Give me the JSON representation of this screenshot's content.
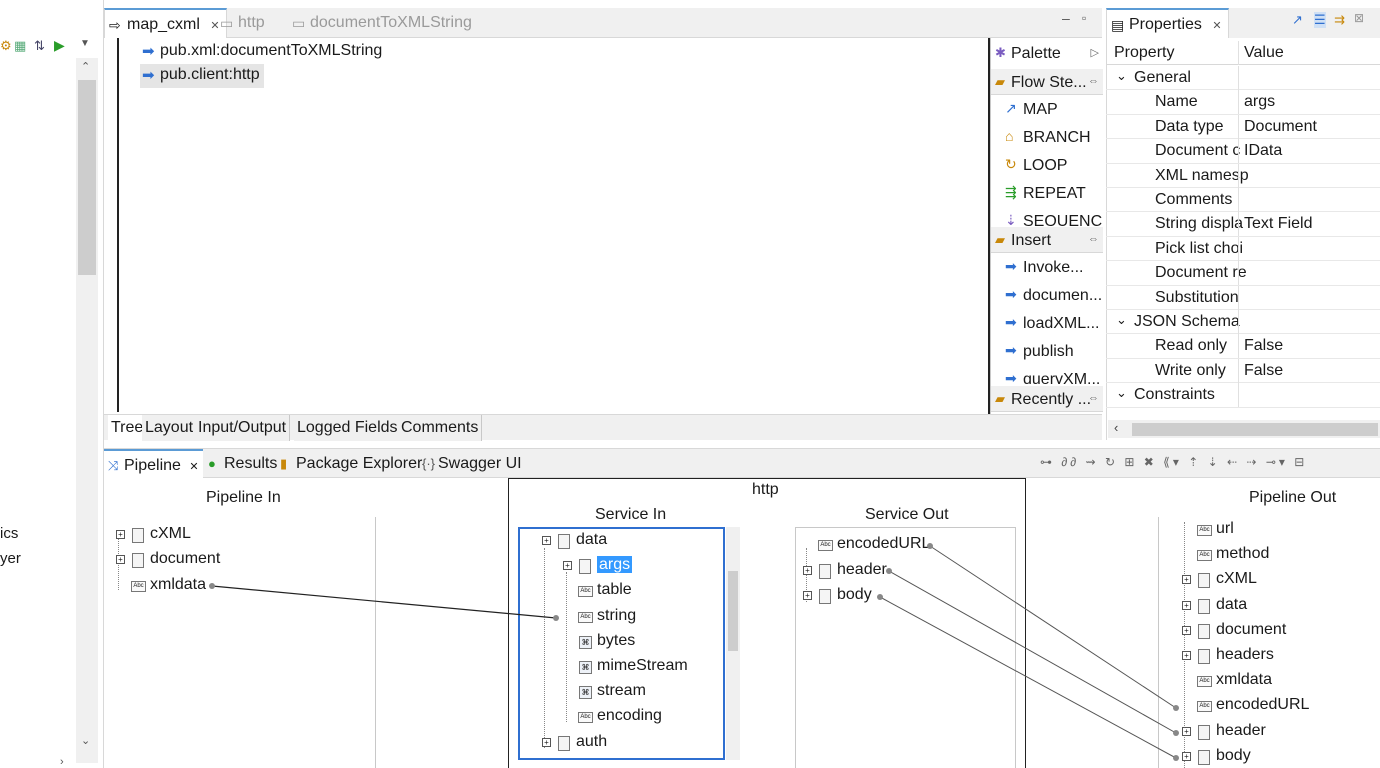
{
  "left": {
    "text1": "ics",
    "text2": "yer"
  },
  "editor": {
    "tabs": [
      {
        "label": "map_cxml",
        "active": true
      },
      {
        "label": "http",
        "active": false
      },
      {
        "label": "documentToXMLString",
        "active": false
      }
    ],
    "flow_items": [
      {
        "label": "pub.xml:documentToXMLString",
        "selected": false
      },
      {
        "label": "pub.client:http",
        "selected": true
      }
    ],
    "bottom_tabs": [
      "Tree",
      "Layout",
      "Input/Output",
      "Logged Fields",
      "Comments"
    ]
  },
  "palette": {
    "title": "Palette",
    "flow_steps_title": "Flow Ste...",
    "flow_steps": [
      "MAP",
      "BRANCH",
      "LOOP",
      "REPEAT",
      "SEQUENCE"
    ],
    "insert_title": "Insert",
    "insert_items": [
      "Invoke...",
      "documen...",
      "loadXML...",
      "publish",
      "queryXM..."
    ],
    "recently_title": "Recently ..."
  },
  "properties": {
    "title": "Properties",
    "col_property": "Property",
    "col_value": "Value",
    "rows": [
      {
        "key": "General",
        "value": "",
        "group": true
      },
      {
        "key": "Name",
        "value": "args",
        "group": false
      },
      {
        "key": "Data type",
        "value": "Document",
        "group": false
      },
      {
        "key": "Document c",
        "value": "IData",
        "group": false
      },
      {
        "key": "XML namesp",
        "value": "",
        "group": false
      },
      {
        "key": "Comments",
        "value": "",
        "group": false
      },
      {
        "key": "String displa",
        "value": "Text Field",
        "group": false
      },
      {
        "key": "Pick list choi",
        "value": "",
        "group": false
      },
      {
        "key": "Document re",
        "value": "",
        "group": false
      },
      {
        "key": "Substitution",
        "value": "",
        "group": false
      },
      {
        "key": "JSON Schema",
        "value": "",
        "group": true
      },
      {
        "key": "Read only",
        "value": "False",
        "group": false
      },
      {
        "key": "Write only",
        "value": "False",
        "group": false
      },
      {
        "key": "Constraints",
        "value": "",
        "group": true
      }
    ]
  },
  "pipeline": {
    "tabs": [
      "Pipeline",
      "Results",
      "Package Explorer",
      "Swagger UI"
    ],
    "pipeline_in_title": "Pipeline In",
    "pipeline_in": [
      {
        "label": "cXML",
        "type": "doc",
        "expandable": true
      },
      {
        "label": "document",
        "type": "doc",
        "expandable": true
      },
      {
        "label": "xmldata",
        "type": "abc",
        "expandable": false
      }
    ],
    "service_title": "http",
    "service_in_title": "Service In",
    "service_in": [
      {
        "label": "data",
        "type": "doc",
        "expandable": true,
        "level": 0
      },
      {
        "label": "args",
        "type": "doc",
        "expandable": true,
        "level": 1,
        "selected": true
      },
      {
        "label": "table",
        "type": "abc",
        "expandable": false,
        "level": 1
      },
      {
        "label": "string",
        "type": "abc",
        "expandable": false,
        "level": 1
      },
      {
        "label": "bytes",
        "type": "obj",
        "expandable": false,
        "level": 1
      },
      {
        "label": "mimeStream",
        "type": "obj",
        "expandable": false,
        "level": 1
      },
      {
        "label": "stream",
        "type": "obj",
        "expandable": false,
        "level": 1
      },
      {
        "label": "encoding",
        "type": "abc",
        "expandable": false,
        "level": 1
      },
      {
        "label": "auth",
        "type": "doc",
        "expandable": true,
        "level": 0
      }
    ],
    "service_out_title": "Service Out",
    "service_out": [
      {
        "label": "encodedURL",
        "type": "abc",
        "expandable": false
      },
      {
        "label": "header",
        "type": "doc",
        "expandable": true
      },
      {
        "label": "body",
        "type": "doc",
        "expandable": true
      }
    ],
    "pipeline_out_title": "Pipeline Out",
    "pipeline_out": [
      {
        "label": "url",
        "type": "abc",
        "expandable": false
      },
      {
        "label": "method",
        "type": "abc",
        "expandable": false
      },
      {
        "label": "cXML",
        "type": "doc",
        "expandable": true
      },
      {
        "label": "data",
        "type": "doc",
        "expandable": true
      },
      {
        "label": "document",
        "type": "doc",
        "expandable": true
      },
      {
        "label": "headers",
        "type": "doc",
        "expandable": true
      },
      {
        "label": "xmldata",
        "type": "abc",
        "expandable": false
      },
      {
        "label": "encodedURL",
        "type": "abc",
        "expandable": false
      },
      {
        "label": "header",
        "type": "doc",
        "expandable": true
      },
      {
        "label": "body",
        "type": "doc",
        "expandable": true
      }
    ]
  },
  "colors": {
    "selection": "#3399ff",
    "accent": "#5b9bd5",
    "link_line": "#555555"
  }
}
